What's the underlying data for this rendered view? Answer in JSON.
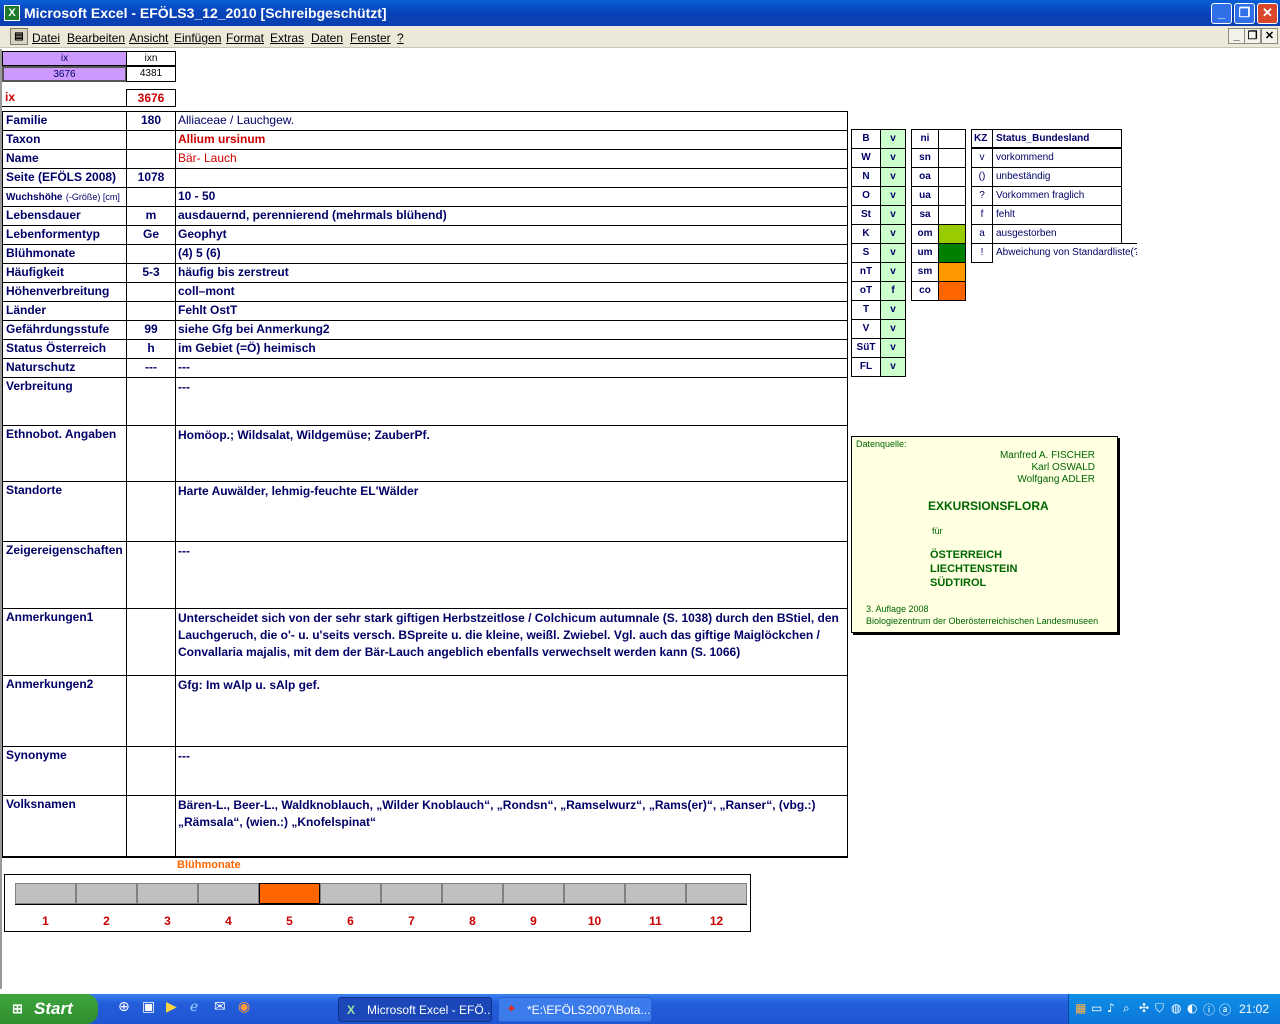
{
  "window": {
    "title": "Microsoft Excel - EFÖLS3_12_2010  [Schreibgeschützt]"
  },
  "menu": [
    "Datei",
    "Bearbeiten",
    "Ansicht",
    "Einfügen",
    "Format",
    "Extras",
    "Daten",
    "Fenster",
    "?"
  ],
  "top": {
    "ix_label": "ix",
    "ixn_label": "ixn",
    "ix_value": "3676",
    "ixn_value": "4381",
    "ix_label2": "ix",
    "ix_value2": "3676"
  },
  "rows": [
    {
      "label": "Familie",
      "code": "180",
      "value": "Alliaceae / Lauchgew."
    },
    {
      "label": "Taxon",
      "code": "",
      "value": "Allium ursinum"
    },
    {
      "label": "Name",
      "code": "",
      "value": "Bär- Lauch"
    },
    {
      "label": "Seite (EFÖLS 2008)",
      "code": "1078",
      "value": ""
    },
    {
      "label": "Wuchshöhe",
      "label_suffix": "(-Größe) [cm]",
      "code": "",
      "value": "10 - 50"
    },
    {
      "label": "Lebensdauer",
      "code": "m",
      "value": "ausdauernd, perennierend (mehrmals blühend)"
    },
    {
      "label": "Lebenformentyp",
      "code": "Ge",
      "value": "Geophyt"
    },
    {
      "label": "Blühmonate",
      "code": "",
      "value": "(4) 5 (6)"
    },
    {
      "label": "Häufigkeit",
      "code": "5-3",
      "value": "häufig bis zerstreut"
    },
    {
      "label": "Höhenverbreitung",
      "code": "",
      "value": "coll–mont"
    },
    {
      "label": "Länder",
      "code": "",
      "value": "Fehlt OstT"
    },
    {
      "label": "Gefährdungsstufe",
      "code": "99",
      "value": "siehe Gfg bei Anmerkung2"
    },
    {
      "label": "Status Österreich",
      "code": "h",
      "value": "im Gebiet (=Ö) heimisch"
    },
    {
      "label": "Naturschutz",
      "code": "---",
      "value": "---"
    },
    {
      "label": "Verbreitung",
      "code": "",
      "value": "---"
    },
    {
      "label": "Ethnobot. Angaben",
      "code": "",
      "value": "Homöop.; Wildsalat, Wildgemüse; ZauberPf."
    },
    {
      "label": "Standorte",
      "code": "",
      "value": "Harte Auwälder, lehmig-feuchte EL'Wälder"
    },
    {
      "label": "Zeigereigenschaften",
      "code": "",
      "value": "---"
    },
    {
      "label": "Anmerkungen1",
      "code": "",
      "value": "Unterscheidet sich von der sehr stark giftigen Herbstzeitlose / Colchicum autumnale (S. 1038) durch den BStiel, den Lauchgeruch, die o'- u. u'seits versch. BSpreite u. die kleine, weißl. Zwiebel. Vgl. auch das giftige Maiglöckchen / Convallaria majalis, mit dem der Bär-Lauch angeblich ebenfalls verwechselt werden kann (S. 1066)"
    },
    {
      "label": "Anmerkungen2",
      "code": "",
      "value": "Gfg:  Im wAlp u. sAlp gef."
    },
    {
      "label": "Synonyme",
      "code": "",
      "value": "---"
    },
    {
      "label": "Volksnamen",
      "code": "",
      "value": "Bären-L., Beer-L., Waldknoblauch, „Wilder Knoblauch“, „Rondsn“, „Ramselwurz“, „Rams(er)“, „Ranser“, (vbg.:) „Rämsala“, (wien.:) „Knofelspinat“"
    }
  ],
  "regions": [
    {
      "code": "B",
      "v": "v"
    },
    {
      "code": "W",
      "v": "v"
    },
    {
      "code": "N",
      "v": "v"
    },
    {
      "code": "O",
      "v": "v"
    },
    {
      "code": "St",
      "v": "v"
    },
    {
      "code": "K",
      "v": "v"
    },
    {
      "code": "S",
      "v": "v"
    },
    {
      "code": "nT",
      "v": "v"
    },
    {
      "code": "oT",
      "v": "f"
    },
    {
      "code": "T",
      "v": "v"
    },
    {
      "code": "V",
      "v": "v"
    },
    {
      "code": "SüT",
      "v": "v"
    },
    {
      "code": "FL",
      "v": "v"
    }
  ],
  "zones": [
    {
      "code": "ni",
      "color": "#ffffff"
    },
    {
      "code": "sn",
      "color": "#ffffff"
    },
    {
      "code": "oa",
      "color": "#ffffff"
    },
    {
      "code": "ua",
      "color": "#ffffff"
    },
    {
      "code": "sa",
      "color": "#ffffff"
    },
    {
      "code": "om",
      "color": "#99cc00"
    },
    {
      "code": "um",
      "color": "#008000"
    },
    {
      "code": "sm",
      "color": "#ff9900"
    },
    {
      "code": "co",
      "color": "#ff6600"
    }
  ],
  "legend": {
    "header_kz": "KZ",
    "header_status": "Status_Bundesland",
    "items": [
      {
        "kz": "v",
        "text": "vorkommend"
      },
      {
        "kz": "()",
        "text": "unbeständig"
      },
      {
        "kz": "?",
        "text": "Vorkommen fraglich"
      },
      {
        "kz": "f",
        "text": "fehlt"
      },
      {
        "kz": "a",
        "text": "ausgestorben"
      },
      {
        "kz": "!",
        "text": "Abweichung von Standardliste(?)"
      }
    ]
  },
  "source": {
    "label": "Datenquelle:",
    "authors": [
      "Manfred A. FISCHER",
      "Karl OSWALD",
      "Wolfgang ADLER"
    ],
    "title": "EXKURSIONSFLORA",
    "fuer": "für",
    "countries": [
      "ÖSTERREICH",
      "LIECHTENSTEIN",
      "SÜDTIROL"
    ],
    "edition": "3. Auflage 2008",
    "publisher": "Biologiezentrum der Oberösterreichischen Landesmuseen"
  },
  "bloom": {
    "title": "Blühmonate",
    "months": [
      "1",
      "2",
      "3",
      "4",
      "5",
      "6",
      "7",
      "8",
      "9",
      "10",
      "11",
      "12"
    ],
    "active": [
      5
    ],
    "active_color": "#ff6600",
    "inactive_color": "#c0c0c0"
  },
  "taskbar": {
    "start": "Start",
    "tasks": [
      "Microsoft Excel - EFÖ...",
      "*E:\\EFÖLS2007\\Bota..."
    ],
    "clock": "21:02"
  }
}
